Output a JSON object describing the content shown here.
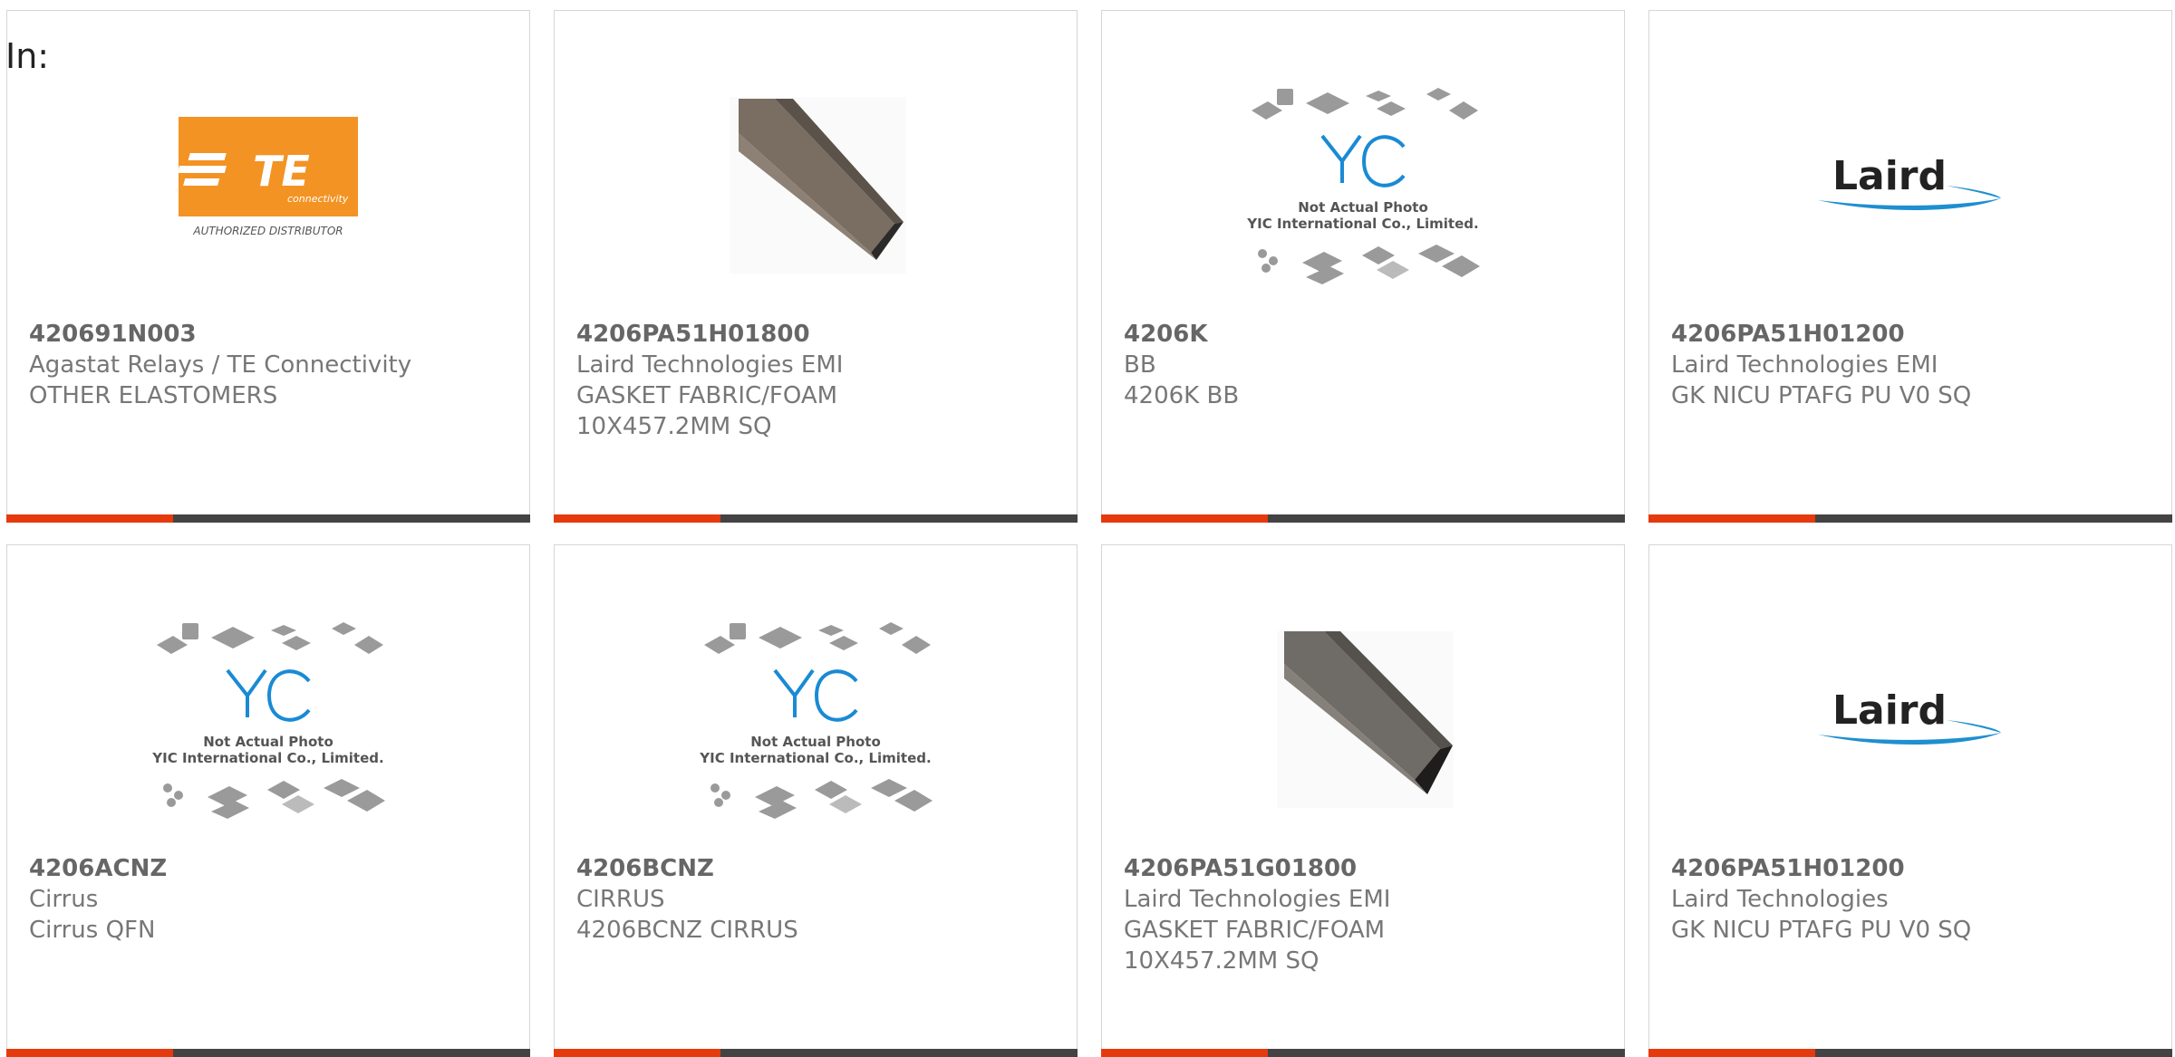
{
  "header": {
    "filter_label": "In:"
  },
  "products": [
    {
      "part_number": "420691N003",
      "manufacturer": "Agastat Relays / TE Connectivity",
      "description_lines": [
        "OTHER ELASTOMERS"
      ],
      "image": "te-connectivity-logo",
      "logo_text": "TE",
      "logo_sub": "connectivity",
      "logo_caption": "AUTHORIZED DISTRIBUTOR"
    },
    {
      "part_number": "4206PA51H01800",
      "manufacturer": "Laird Technologies EMI",
      "description_lines": [
        "GASKET FABRIC/FOAM",
        "10X457.2MM SQ"
      ],
      "image": "gasket-bar-photo"
    },
    {
      "part_number": "4206K",
      "manufacturer": "BB",
      "description_lines": [
        "4206K BB"
      ],
      "image": "yic-placeholder",
      "placeholder_line1": "Not Actual Photo",
      "placeholder_line2": "YIC International Co., Limited."
    },
    {
      "part_number": "4206PA51H01200",
      "manufacturer": "Laird Technologies EMI",
      "description_lines": [
        "GK NICU PTAFG PU V0 SQ"
      ],
      "image": "laird-logo",
      "logo_text": "Laird"
    },
    {
      "part_number": "4206ACNZ",
      "manufacturer": "Cirrus",
      "description_lines": [
        "Cirrus QFN"
      ],
      "image": "yic-placeholder",
      "placeholder_line1": "Not Actual Photo",
      "placeholder_line2": "YIC International Co., Limited."
    },
    {
      "part_number": "4206BCNZ",
      "manufacturer": "CIRRUS",
      "description_lines": [
        "4206BCNZ CIRRUS"
      ],
      "image": "yic-placeholder",
      "placeholder_line1": "Not Actual Photo",
      "placeholder_line2": "YIC International Co., Limited."
    },
    {
      "part_number": "4206PA51G01800",
      "manufacturer": "Laird Technologies EMI",
      "description_lines": [
        "GASKET FABRIC/FOAM",
        "10X457.2MM SQ"
      ],
      "image": "gasket-bar-photo"
    },
    {
      "part_number": "4206PA51H01200",
      "manufacturer": "Laird Technologies",
      "description_lines": [
        "GK NICU PTAFG PU V0 SQ"
      ],
      "image": "laird-logo",
      "logo_text": "Laird"
    }
  ],
  "colors": {
    "accent_bar": "#e53a0e",
    "dark_bar": "#434343",
    "te_orange": "#f39323",
    "laird_blue": "#1e8fd0",
    "yic_blue": "#1a8ad4"
  }
}
